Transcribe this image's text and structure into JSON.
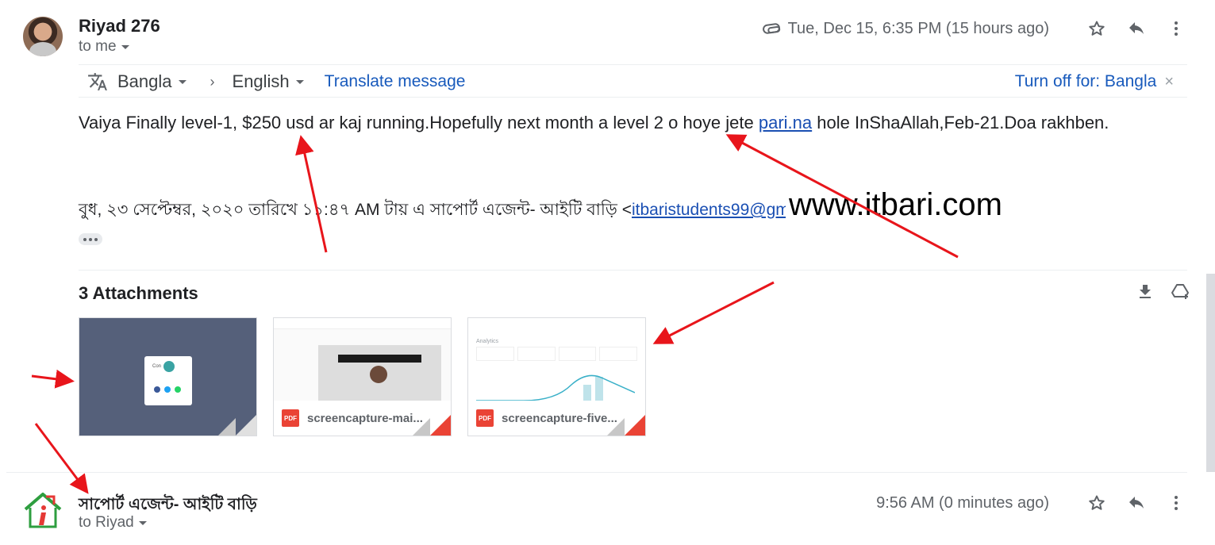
{
  "message1": {
    "sender": "Riyad 276",
    "recipient_label": "to me",
    "date": "Tue, Dec 15, 6:35 PM (15 hours ago)",
    "icons": [
      "attachment-icon",
      "star-icon",
      "reply-icon",
      "more-vert-icon"
    ]
  },
  "translate": {
    "source_lang": "Bangla",
    "target_lang": "English",
    "translate_link": "Translate message",
    "turn_off": "Turn off for: Bangla",
    "close": "×"
  },
  "body": {
    "text_before_link": "Vaiya Finally level-1, $250 usd ar kaj running.Hopefully next month a level 2 o hoye jete ",
    "link": "pari.na",
    "text_after_link": " hole InShaAllah,Feb-21.Doa rakhben.",
    "quote_prefix": "বুধ, ২৩ সেপ্টেম্বর, ২০২০ তারিখে ১১:৪৭ AM টায় এ সাপোর্ট এজেন্ট- আইটি বাড়ি <",
    "quote_email": "itbaristudents99@gmail.com"
  },
  "watermark": "www.itbari.com",
  "attachments": {
    "title": "3 Attachments",
    "items": [
      {
        "name": ""
      },
      {
        "name": "screencapture-mai...",
        "type": "PDF"
      },
      {
        "name": "screencapture-five...",
        "type": "PDF"
      }
    ],
    "thumb1_popup_text": "Con",
    "thumb3_heading": "Analytics"
  },
  "message2": {
    "sender": "সাপোর্ট এজেন্ট- আইটি বাড়ি",
    "recipient_label": "to Riyad",
    "date": "9:56 AM (0 minutes ago)"
  },
  "colors": {
    "link": "#1a4fb3",
    "translate_link": "#185abc",
    "annotation_arrow": "#e8151b",
    "pdf_red": "#ea4335"
  }
}
